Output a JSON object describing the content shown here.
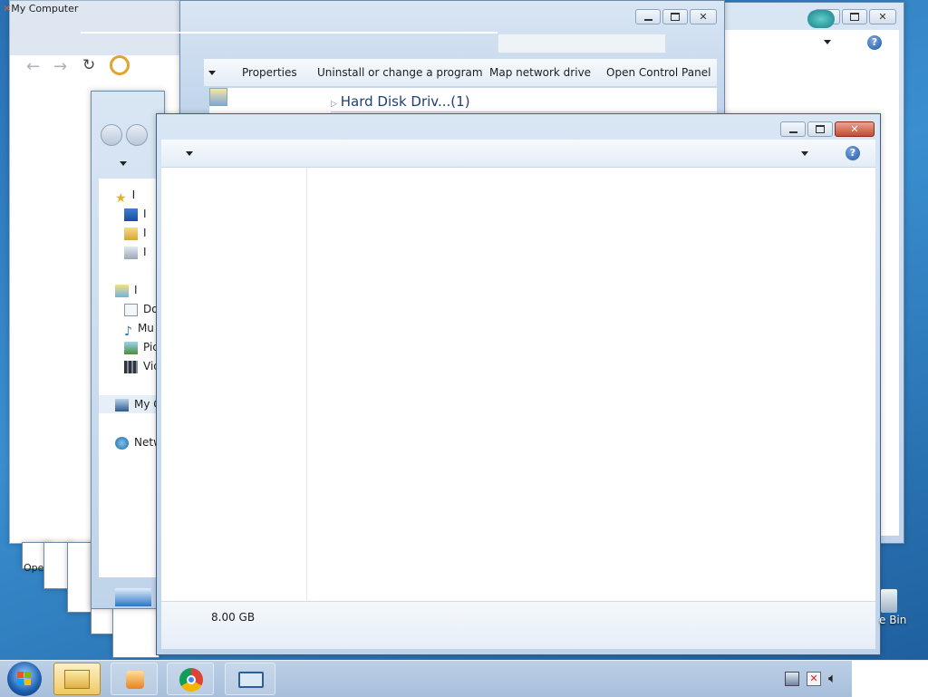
{
  "browser": {
    "tab_title": "My Computer",
    "back_icon": "back-arrow-icon",
    "forward_icon": "forward-arrow-icon",
    "reload_icon": "reload-icon"
  },
  "computer_window": {
    "toolbar": {
      "properties": "Properties",
      "uninstall": "Uninstall or change a program",
      "map_drive": "Map network drive",
      "control_panel": "Open Control Panel"
    },
    "group_header": "Hard Disk Driv...(1)"
  },
  "explorer_left": {
    "items": [
      "I",
      "I",
      "I",
      "I",
      "I",
      "Do",
      "Mu",
      "Pic",
      "Vid",
      "My C",
      "Netw"
    ]
  },
  "front_window": {
    "status": "8.00 GB",
    "help": "?"
  },
  "desktop": {
    "recycle_bin_label": "e Bin",
    "open_label": "Ope"
  },
  "taskbar": {
    "items": [
      {
        "name": "start-button"
      },
      {
        "name": "explorer"
      },
      {
        "name": "media-player"
      },
      {
        "name": "chrome"
      },
      {
        "name": "remote-desktop"
      }
    ]
  },
  "colors": {
    "accent": "#1f57a8",
    "close": "#c64b33",
    "taskbar_active": "#f1c964"
  }
}
